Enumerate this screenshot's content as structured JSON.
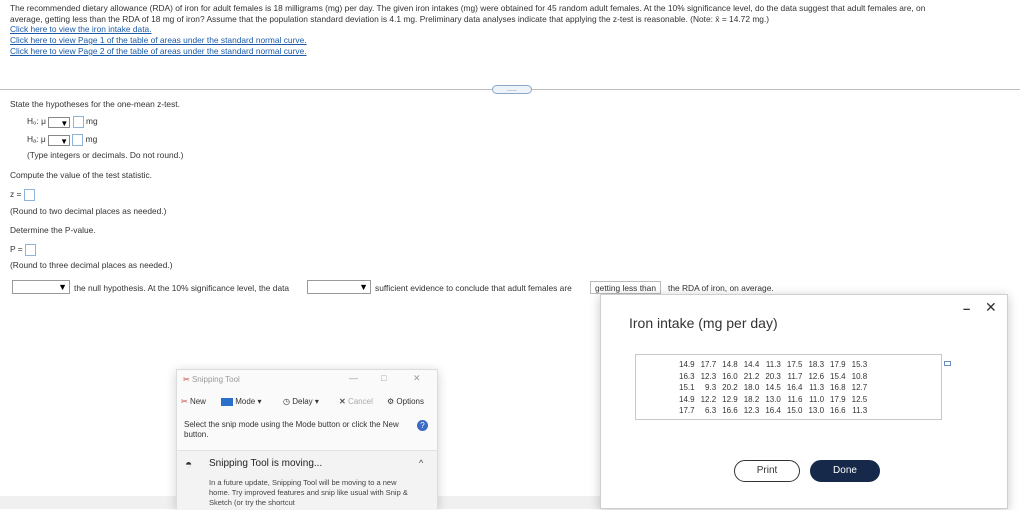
{
  "problem": {
    "line1": "The recommended dietary allowance (RDA) of iron for adult females is 18 milligrams (mg) per day. The given iron intakes (mg) were obtained for 45 random adult females. At the 10% significance level, do the data suggest that adult females are, on",
    "line2": "average, getting less than the RDA of 18 mg of iron? Assume that the population standard deviation is 4.1 mg. Preliminary data analyses indicate that applying the z-test is reasonable. (Note: x̄ = 14.72 mg.)",
    "links": [
      "Click here to view the iron intake data.",
      "Click here to view Page 1 of the table of areas under the standard normal curve.",
      "Click here to view Page 2 of the table of areas under the standard normal curve."
    ],
    "expand_label": "....."
  },
  "questions": {
    "hyp_prompt": "State the hypotheses for the one-mean z-test.",
    "h0_label": "H₀: μ",
    "ha_label": "Hₐ: μ",
    "unit": "mg",
    "hyp_note": "(Type integers or decimals. Do not round.)",
    "stat_prompt": "Compute the value of the test statistic.",
    "z_label": "z =",
    "z_note": "(Round to two decimal places as needed.)",
    "p_prompt": "Determine the P-value.",
    "p_label": "P =",
    "p_note": "(Round to three decimal places as needed.)",
    "conclusion_1": "the null hypothesis. At the 10% significance level, the data",
    "conclusion_2": "sufficient evidence to conclude that adult females are",
    "conclusion_choice": "getting less than",
    "conclusion_3": "the RDA of iron, on average."
  },
  "snipping_tool": {
    "title": "Snipping Tool",
    "minimize": "—",
    "maximize": "□",
    "close": "✕",
    "new_label": "New",
    "mode_label": "Mode",
    "delay_label": "Delay",
    "cancel_label": "Cancel",
    "options_label": "Options",
    "hint": "Select the snip mode using the Mode button or click the New button.",
    "moving_title": "Snipping Tool is moving...",
    "moving_body": "In a future update, Snipping Tool will be moving to a new home. Try improved features and snip like usual with Snip & Sketch (or try the shortcut"
  },
  "modal": {
    "title": "Iron intake (mg per day)",
    "minimize": "–",
    "close": "✕",
    "rows": [
      [
        "14.9",
        "17.7",
        "14.8",
        "14.4",
        "11.3",
        "17.5",
        "18.3",
        "17.9",
        "15.3"
      ],
      [
        "16.3",
        "12.3",
        "16.0",
        "21.2",
        "20.3",
        "11.7",
        "12.6",
        "15.4",
        "10.8"
      ],
      [
        "15.1",
        "9.3",
        "20.2",
        "18.0",
        "14.5",
        "16.4",
        "11.3",
        "16.8",
        "12.7"
      ],
      [
        "14.9",
        "12.2",
        "12.9",
        "18.2",
        "13.0",
        "11.6",
        "11.0",
        "17.9",
        "12.5"
      ],
      [
        "17.7",
        "6.3",
        "16.6",
        "12.3",
        "16.4",
        "15.0",
        "13.0",
        "16.6",
        "11.3"
      ]
    ],
    "print_label": "Print",
    "done_label": "Done"
  }
}
